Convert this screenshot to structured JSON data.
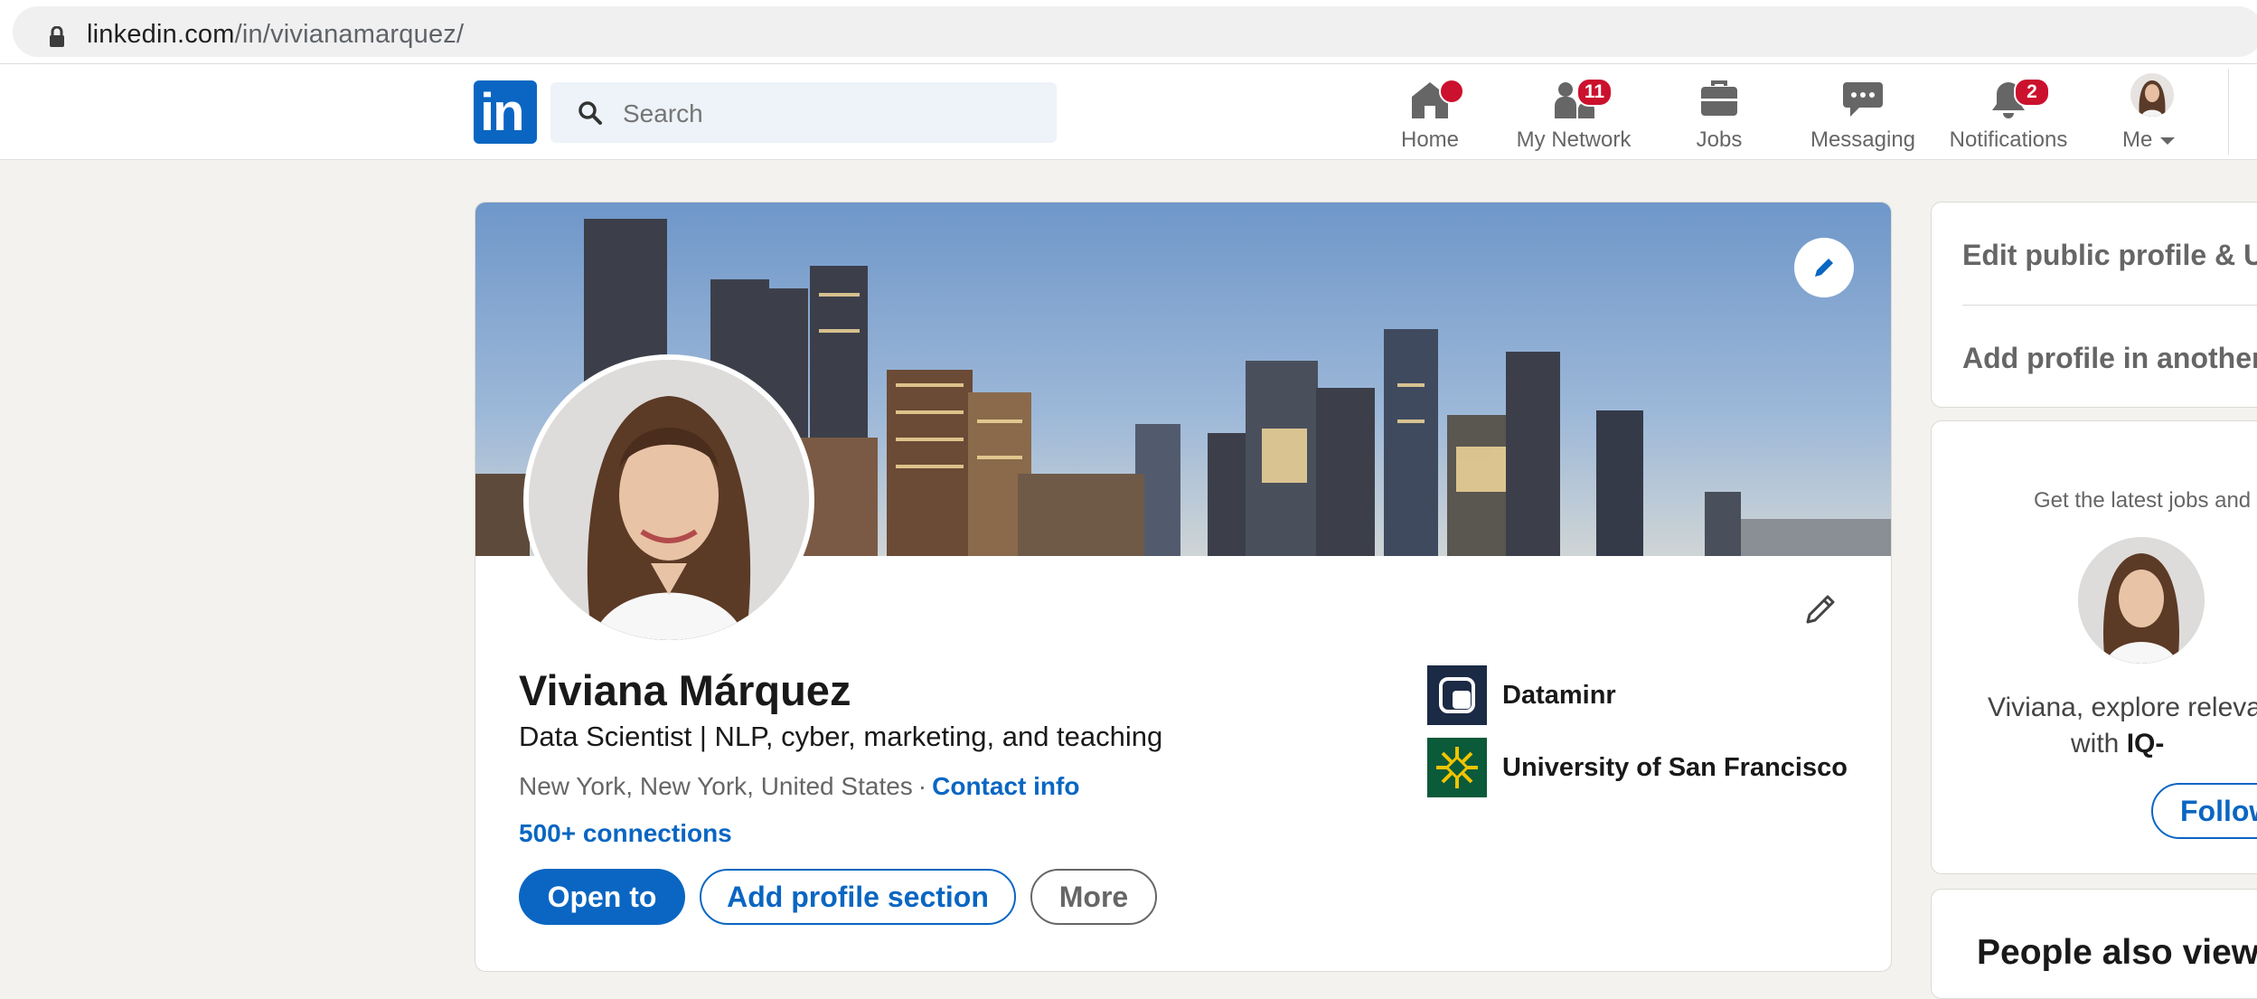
{
  "browser": {
    "url_domain": "linkedin.com",
    "url_path": "/in/vivianamarquez/"
  },
  "nav": {
    "logo_text": "in",
    "search_placeholder": "Search",
    "items": [
      {
        "label": "Home",
        "icon": "home-icon",
        "badge": ""
      },
      {
        "label": "My Network",
        "icon": "people-icon",
        "badge": "11"
      },
      {
        "label": "Jobs",
        "icon": "briefcase-icon",
        "badge": ""
      },
      {
        "label": "Messaging",
        "icon": "chat-icon",
        "badge": ""
      },
      {
        "label": "Notifications",
        "icon": "bell-icon",
        "badge": "2"
      },
      {
        "label": "Me",
        "icon": "avatar",
        "badge": ""
      }
    ]
  },
  "profile": {
    "name": "Viviana Márquez",
    "headline": "Data Scientist | NLP, cyber, marketing, and teaching",
    "location": "New York, New York, United States",
    "location_separator": "·",
    "contact_info": "Contact info",
    "connections": "500+ connections",
    "buttons": {
      "open_to": "Open to",
      "add_section": "Add profile section",
      "more": "More"
    },
    "companies": [
      {
        "name": "Dataminr"
      },
      {
        "name": "University of San Francisco"
      }
    ]
  },
  "right_rail": {
    "edit_public_profile": "Edit public profile & U",
    "add_language": "Add profile in another",
    "ad": {
      "tagline": "Get the latest jobs and",
      "line1": "Viviana, explore releva",
      "line2_prefix": "with ",
      "line2_bold": "IQ-",
      "follow": "Follow"
    },
    "people_also_viewed": "People also viewe"
  },
  "colors": {
    "brand_blue": "#0a66c2",
    "badge_red": "#cb112d",
    "page_bg": "#f4f2ee"
  }
}
